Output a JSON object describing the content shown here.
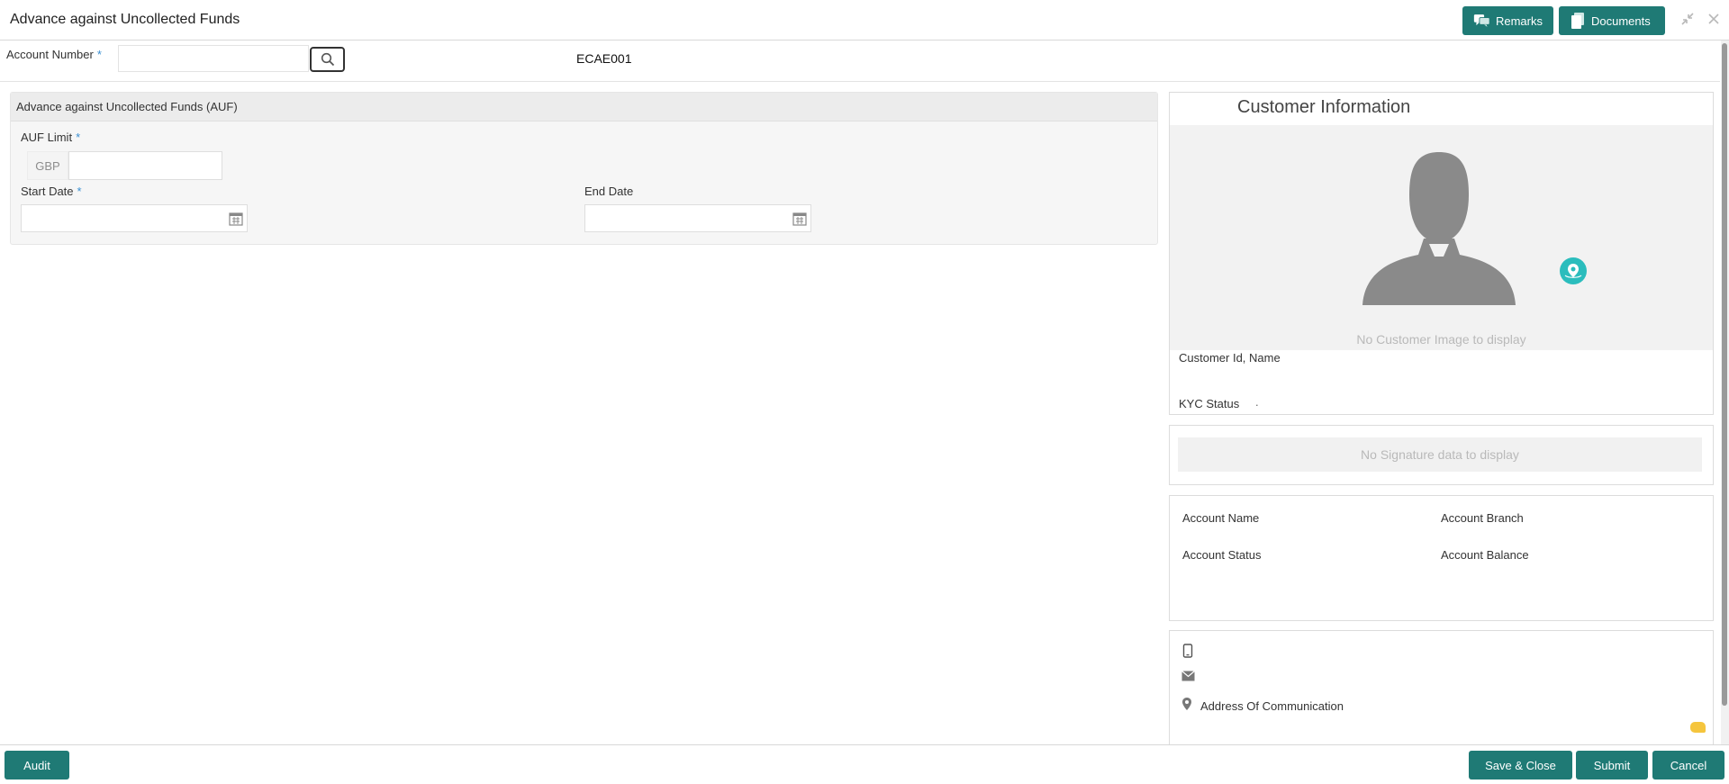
{
  "window": {
    "title": "Advance against Uncollected Funds",
    "remarks_label": "Remarks",
    "documents_label": "Documents",
    "minimize_icon": "minimize-icon",
    "close_icon": "close-icon"
  },
  "account": {
    "label": "Account Number",
    "required": "*",
    "value": "",
    "code": "ECAE001"
  },
  "auf": {
    "section_title": "Advance against Uncollected Funds (AUF)",
    "limit_label": "AUF Limit",
    "required": "*",
    "currency": "GBP",
    "limit_value": "",
    "start_label": "Start Date",
    "end_label": "End Date",
    "start_value": "",
    "end_value": ""
  },
  "customer": {
    "title": "Customer Information",
    "no_image": "No Customer Image to display",
    "id_name_label": "Customer Id, Name",
    "kyc_label": "KYC Status",
    "kyc_value": ".",
    "no_signature": "No Signature data to display",
    "account_name_label": "Account Name",
    "account_branch_label": "Account Branch",
    "account_status_label": "Account Status",
    "account_balance_label": "Account Balance",
    "address_label": "Address Of Communication"
  },
  "footer": {
    "audit": "Audit",
    "save_close": "Save & Close",
    "submit": "Submit",
    "cancel": "Cancel"
  },
  "colors": {
    "accent": "#1f7a75",
    "required": "#3a8fd1",
    "teal_badge": "#2bbdbd",
    "yellow_chip": "#f5c53d"
  }
}
